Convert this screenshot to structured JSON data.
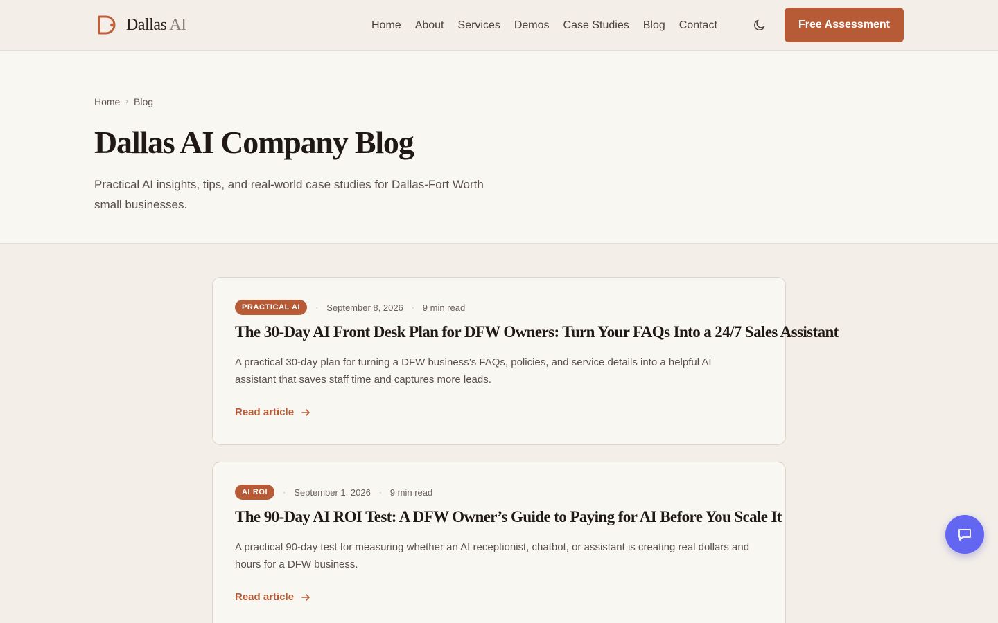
{
  "header": {
    "logo_name": "Dallas",
    "logo_suffix": "AI",
    "nav": [
      "Home",
      "About",
      "Services",
      "Demos",
      "Case Studies",
      "Blog",
      "Contact"
    ],
    "theme_toggle_icon": "moon-icon",
    "cta_label": "Free Assessment"
  },
  "hero": {
    "breadcrumb": [
      "Home",
      "Blog"
    ],
    "title": "Dallas AI Company Blog",
    "subtitle": "Practical AI insights, tips, and real-world case studies for Dallas-Fort Worth small businesses."
  },
  "posts": [
    {
      "category": "PRACTICAL AI",
      "date": "September 8, 2026",
      "read_time": "9 min read",
      "title": "The 30-Day AI Front Desk Plan for DFW Owners: Turn Your FAQs Into a 24/7 Sales Assistant",
      "excerpt": "A practical 30-day plan for turning a DFW business’s FAQs, policies, and service details into a helpful AI assistant that saves staff time and captures more leads.",
      "link_label": "Read article"
    },
    {
      "category": "AI ROI",
      "date": "September 1, 2026",
      "read_time": "9 min read",
      "title": "The 90-Day AI ROI Test: A DFW Owner’s Guide to Paying for AI Before You Scale It",
      "excerpt": "A practical 90-day test for measuring whether an AI receptionist, chatbot, or assistant is creating real dollars and hours for a DFW business.",
      "link_label": "Read article"
    }
  ],
  "colors": {
    "accent": "#b75a36",
    "chat": "#6366f1",
    "background": "#f3efe8",
    "surface": "#f9f7f2"
  },
  "chat_icon": "chat-bubble-icon"
}
